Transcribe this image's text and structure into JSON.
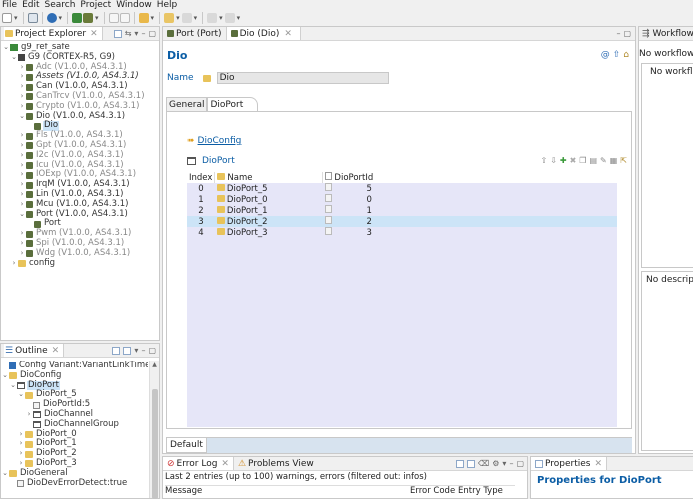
{
  "menu": [
    "File",
    "Edit",
    "Search",
    "Project",
    "Window",
    "Help"
  ],
  "colors": {
    "accent": "#0b5da5",
    "selection": "#cce4f7",
    "table_bg": "#e6e6f8",
    "folder": "#e8c35a",
    "module": "#5a6e3c"
  },
  "project_explorer": {
    "title": "Project Explorer",
    "items": [
      {
        "label": "g9_ref_safe",
        "depth": 0,
        "tw": "⌄",
        "icon": "project"
      },
      {
        "label": "G9 (CORTEX-R5, G9)",
        "depth": 1,
        "tw": "⌄",
        "icon": "chip"
      },
      {
        "label": "Adc (V1.0.0, AS4.3.1)",
        "depth": 2,
        "tw": "›",
        "icon": "module",
        "style": "grey"
      },
      {
        "label": "Assets (V1.0.0, AS4.3.1)",
        "depth": 2,
        "tw": "›",
        "icon": "module",
        "style": "italic"
      },
      {
        "label": "Can (V1.0.0, AS4.3.1)",
        "depth": 2,
        "tw": "›",
        "icon": "module",
        "style": "dark"
      },
      {
        "label": "CanTrcv (V1.0.0, AS4.3.1)",
        "depth": 2,
        "tw": "›",
        "icon": "module",
        "style": "grey"
      },
      {
        "label": "Crypto (V1.0.0, AS4.3.1)",
        "depth": 2,
        "tw": "›",
        "icon": "module",
        "style": "grey"
      },
      {
        "label": "Dio (V1.0.0, AS4.3.1)",
        "depth": 2,
        "tw": "⌄",
        "icon": "module",
        "style": "dark"
      },
      {
        "label": "Dio",
        "depth": 3,
        "tw": "",
        "icon": "module",
        "style": "selected"
      },
      {
        "label": "Fls (V1.0.0, AS4.3.1)",
        "depth": 2,
        "tw": "›",
        "icon": "module",
        "style": "grey"
      },
      {
        "label": "Gpt (V1.0.0, AS4.3.1)",
        "depth": 2,
        "tw": "›",
        "icon": "module",
        "style": "grey"
      },
      {
        "label": "I2c (V1.0.0, AS4.3.1)",
        "depth": 2,
        "tw": "›",
        "icon": "module",
        "style": "grey"
      },
      {
        "label": "Icu (V1.0.0, AS4.3.1)",
        "depth": 2,
        "tw": "›",
        "icon": "module",
        "style": "grey"
      },
      {
        "label": "IOExp (V1.0.0, AS4.3.1)",
        "depth": 2,
        "tw": "›",
        "icon": "module",
        "style": "grey"
      },
      {
        "label": "IrqM (V1.0.0, AS4.3.1)",
        "depth": 2,
        "tw": "›",
        "icon": "module",
        "style": "dark"
      },
      {
        "label": "Lin (V1.0.0, AS4.3.1)",
        "depth": 2,
        "tw": "›",
        "icon": "module",
        "style": "dark"
      },
      {
        "label": "Mcu (V1.0.0, AS4.3.1)",
        "depth": 2,
        "tw": "›",
        "icon": "module",
        "style": "dark"
      },
      {
        "label": "Port (V1.0.0, AS4.3.1)",
        "depth": 2,
        "tw": "⌄",
        "icon": "module",
        "style": "dark"
      },
      {
        "label": "Port",
        "depth": 3,
        "tw": "",
        "icon": "module",
        "style": "dark"
      },
      {
        "label": "Pwm (V1.0.0, AS4.3.1)",
        "depth": 2,
        "tw": "›",
        "icon": "module",
        "style": "grey"
      },
      {
        "label": "Spi (V1.0.0, AS4.3.1)",
        "depth": 2,
        "tw": "›",
        "icon": "module",
        "style": "grey"
      },
      {
        "label": "Wdg (V1.0.0, AS4.3.1)",
        "depth": 2,
        "tw": "›",
        "icon": "module",
        "style": "grey"
      },
      {
        "label": "config",
        "depth": 1,
        "tw": "›",
        "icon": "folder",
        "style": "dark"
      }
    ]
  },
  "outline": {
    "title": "Outline",
    "items": [
      {
        "label": "Config Variant:VariantLinkTime",
        "depth": 0,
        "tw": "",
        "icon": "config"
      },
      {
        "label": "DioConfig",
        "depth": 0,
        "tw": "⌄",
        "icon": "folder"
      },
      {
        "label": "DioPort",
        "depth": 1,
        "tw": "⌄",
        "icon": "table",
        "style": "selected"
      },
      {
        "label": "DioPort_5",
        "depth": 2,
        "tw": "⌄",
        "icon": "folder"
      },
      {
        "label": "DioPortId:5",
        "depth": 3,
        "tw": "",
        "icon": "field"
      },
      {
        "label": "DioChannel",
        "depth": 3,
        "tw": "›",
        "icon": "table"
      },
      {
        "label": "DioChannelGroup",
        "depth": 3,
        "tw": "",
        "icon": "table"
      },
      {
        "label": "DioPort_0",
        "depth": 2,
        "tw": "›",
        "icon": "folder"
      },
      {
        "label": "DioPort_1",
        "depth": 2,
        "tw": "›",
        "icon": "folder"
      },
      {
        "label": "DioPort_2",
        "depth": 2,
        "tw": "›",
        "icon": "folder"
      },
      {
        "label": "DioPort_3",
        "depth": 2,
        "tw": "›",
        "icon": "folder"
      },
      {
        "label": "DioGeneral",
        "depth": 0,
        "tw": "⌄",
        "icon": "folder"
      },
      {
        "label": "DioDevErrorDetect:true",
        "depth": 1,
        "tw": "",
        "icon": "field"
      }
    ]
  },
  "editor": {
    "tabs": [
      {
        "label": "Port (Port)"
      },
      {
        "label": "Dio (Dio)"
      }
    ],
    "title": "Dio",
    "name_label": "Name",
    "name_value": "Dio",
    "subtabs": [
      "General",
      "DioPort"
    ],
    "dioconfig_link": "DioConfig",
    "table_label": "DioPort",
    "headers": [
      "Index",
      "Name",
      "DioPortId"
    ],
    "rows": [
      {
        "index": "0",
        "name": "DioPort_5",
        "id": "5"
      },
      {
        "index": "1",
        "name": "DioPort_0",
        "id": "0"
      },
      {
        "index": "2",
        "name": "DioPort_1",
        "id": "1"
      },
      {
        "index": "3",
        "name": "DioPort_2",
        "id": "2",
        "selected": true
      },
      {
        "index": "4",
        "name": "DioPort_3",
        "id": "3"
      }
    ],
    "bottom_tab": "Default"
  },
  "workflows": {
    "title": "Workflows",
    "line1": "No workflow se",
    "line2": "No workflov",
    "desc": "No descriptio"
  },
  "error_log": {
    "tab1": "Error Log",
    "tab2": "Problems View",
    "summary": "Last 2 entries (up to 100) warnings, errors (filtered out: infos)",
    "col_message": "Message",
    "col_code": "Error Code",
    "col_type": "Entry Type"
  },
  "properties": {
    "tab": "Properties",
    "title": "Properties for DioPort"
  }
}
